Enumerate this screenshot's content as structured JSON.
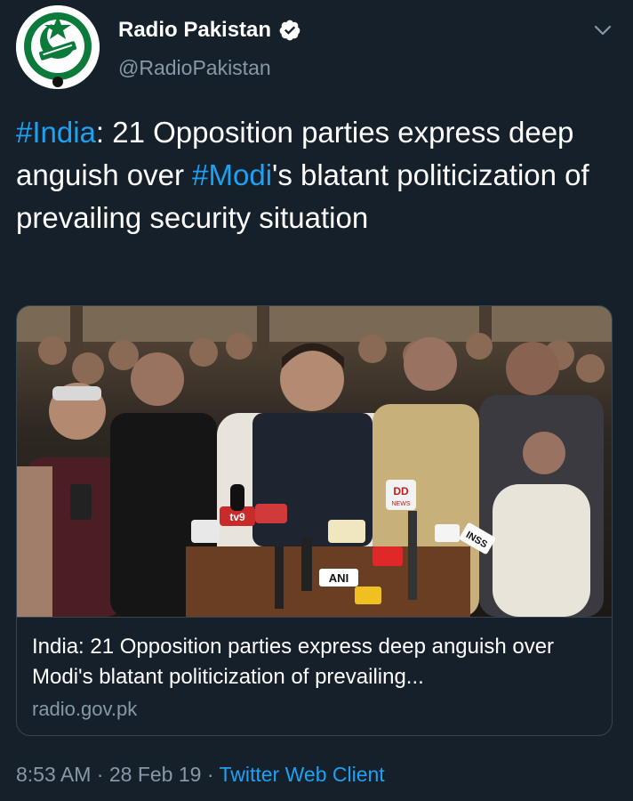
{
  "author": {
    "name": "Radio Pakistan",
    "handle": "@RadioPakistan",
    "verified": true
  },
  "tweet": {
    "parts": [
      {
        "text": "#India",
        "hashtag": true
      },
      {
        "text": ": 21 Opposition parties express deep anguish over ",
        "hashtag": false
      },
      {
        "text": "#Modi",
        "hashtag": true
      },
      {
        "text": "'s blatant politicization of prevailing security situation",
        "hashtag": false
      }
    ]
  },
  "card": {
    "title": "India: 21 Opposition parties express deep anguish over Modi's blatant politicization of prevailing...",
    "domain": "radio.gov.pk",
    "image_labels": {
      "dd": "DD",
      "dd_sub": "NEWS",
      "ani": "ANI",
      "inss": "INSS",
      "tv9": "tv9"
    }
  },
  "meta": {
    "time": "8:53 AM",
    "separator": "·",
    "date": "28 Feb 19",
    "client": "Twitter Web Client"
  },
  "colors": {
    "background": "#15202b",
    "accent": "#1da1f2",
    "secondary_text": "#8899a6",
    "border": "#38444d"
  },
  "icons": {
    "verified": "verified-badge-icon",
    "caret": "chevron-down-icon"
  }
}
